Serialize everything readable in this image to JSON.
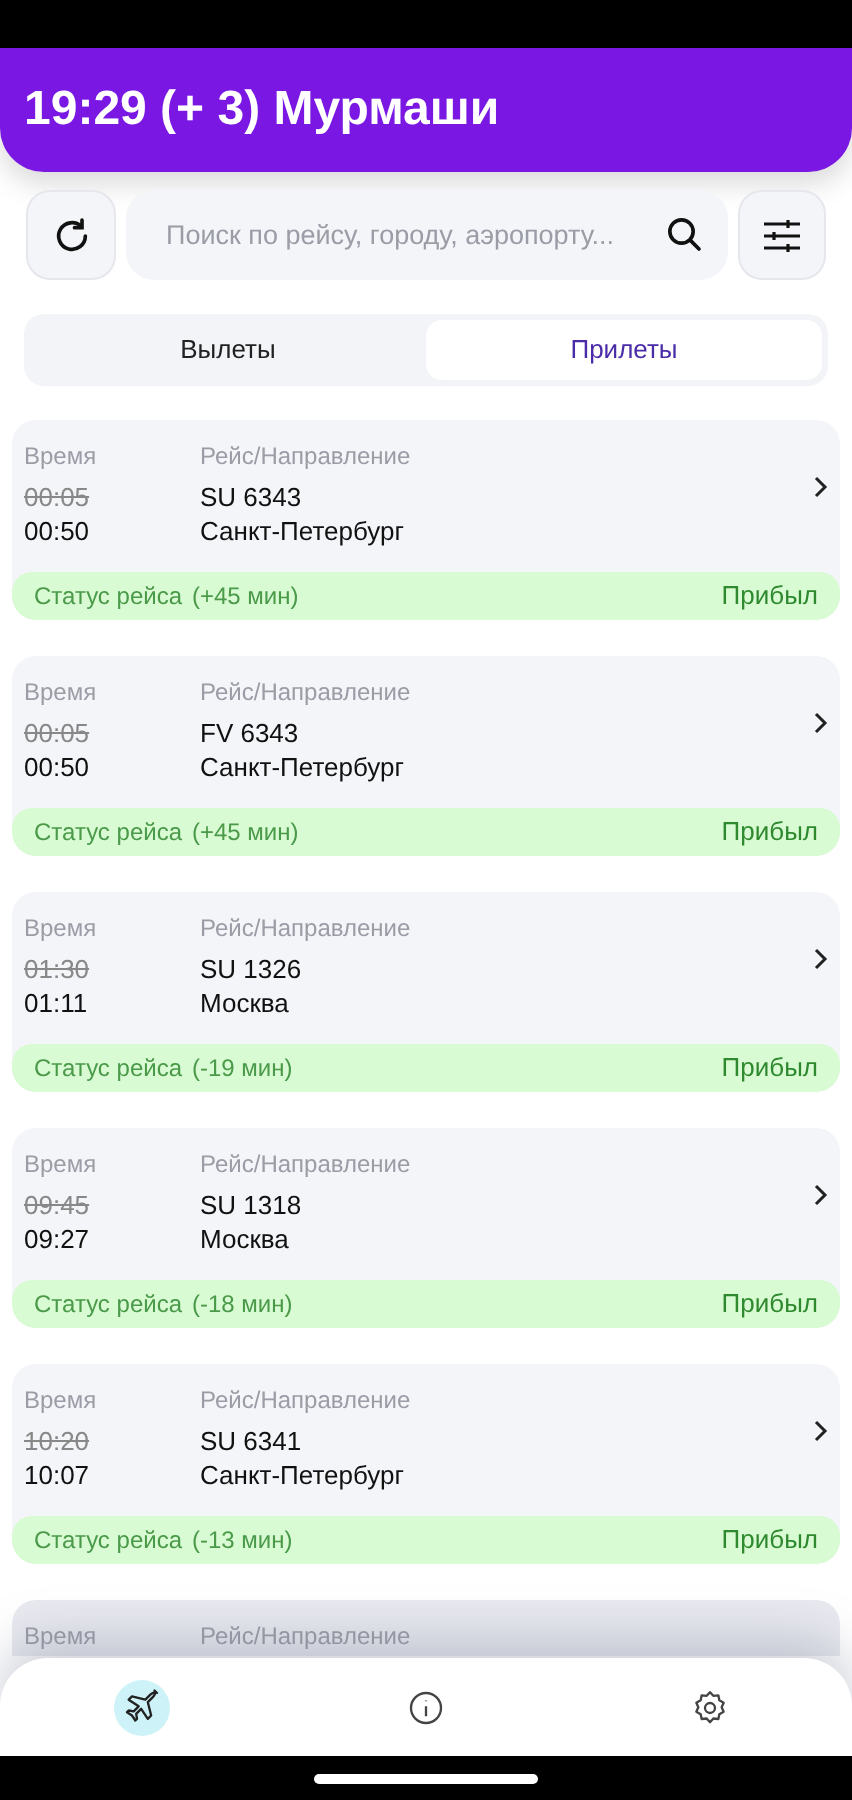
{
  "header": {
    "title": "19:29 (+ 3) Мурмаши"
  },
  "search": {
    "placeholder": "Поиск по рейсу, городу, аэропорту..."
  },
  "tabs": [
    {
      "label": "Вылеты",
      "selected": false
    },
    {
      "label": "Прилеты",
      "selected": true
    }
  ],
  "flights": [
    {
      "time_label": "Время",
      "flight_label": "Рейс/Направление",
      "scheduled": "00:05",
      "actual": "00:50",
      "flight": "SU 6343",
      "city": "Санкт-Петербург",
      "status_label": "Статус рейса",
      "delay": "(+45 мин)",
      "status": "Прибыл"
    },
    {
      "time_label": "Время",
      "flight_label": "Рейс/Направление",
      "scheduled": "00:05",
      "actual": "00:50",
      "flight": "FV 6343",
      "city": "Санкт-Петербург",
      "status_label": "Статус рейса",
      "delay": "(+45 мин)",
      "status": "Прибыл"
    },
    {
      "time_label": "Время",
      "flight_label": "Рейс/Направление",
      "scheduled": "01:30",
      "actual": "01:11",
      "flight": "SU 1326",
      "city": "Москва",
      "status_label": "Статус рейса",
      "delay": "(-19 мин)",
      "status": "Прибыл"
    },
    {
      "time_label": "Время",
      "flight_label": "Рейс/Направление",
      "scheduled": "09:45",
      "actual": "09:27",
      "flight": "SU 1318",
      "city": "Москва",
      "status_label": "Статус рейса",
      "delay": "(-18 мин)",
      "status": "Прибыл"
    },
    {
      "time_label": "Время",
      "flight_label": "Рейс/Направление",
      "scheduled": "10:20",
      "actual": "10:07",
      "flight": "SU 6341",
      "city": "Санкт-Петербург",
      "status_label": "Статус рейса",
      "delay": "(-13 мин)",
      "status": "Прибыл"
    },
    {
      "time_label": "Время",
      "flight_label": "Рейс/Направление"
    }
  ],
  "nav": [
    {
      "kind": "plane",
      "selected": true
    },
    {
      "kind": "info",
      "selected": false
    },
    {
      "kind": "settings",
      "selected": false
    }
  ]
}
